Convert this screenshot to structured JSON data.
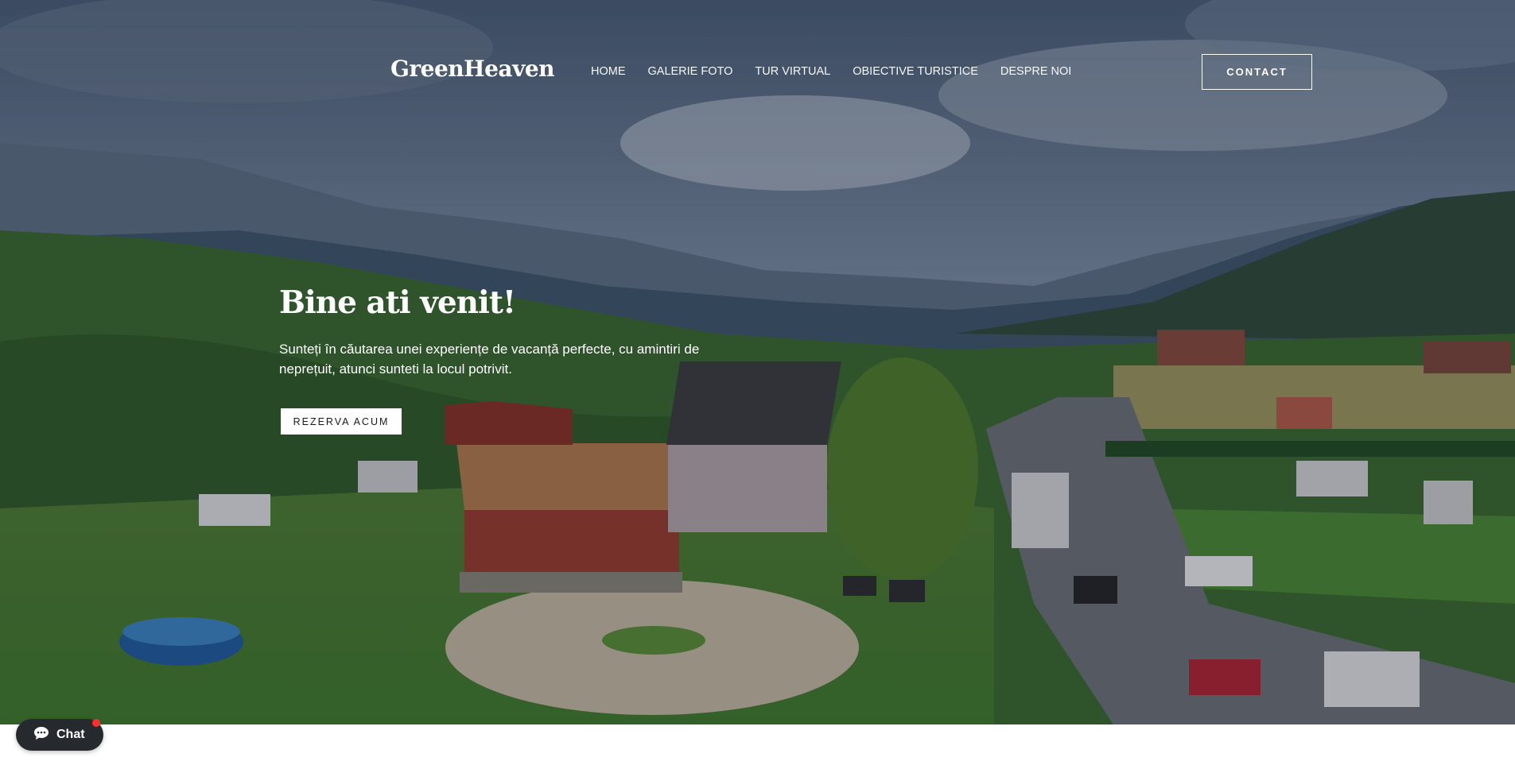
{
  "brand": {
    "logo_text": "GreenHeaven"
  },
  "nav": {
    "items": [
      "HOME",
      "GALERIE FOTO",
      "TUR VIRTUAL",
      "OBIECTIVE TURISTICE",
      "DESPRE NOI"
    ],
    "contact_label": "CONTACT"
  },
  "hero": {
    "title": "Bine ati venit!",
    "subtitle": "Sunteți în căutarea unei experiențe de vacanță perfecte, cu amintiri de neprețuit, atunci sunteti la locul potrivit.",
    "cta_label": "REZERVA ACUM"
  },
  "chat": {
    "label": "Chat",
    "icon": "chat-bubble-icon",
    "badge_color": "#ff2d2d"
  },
  "colors": {
    "overlay": "#141e2d",
    "text": "#ffffff",
    "chat_bg": "#262a2e"
  }
}
